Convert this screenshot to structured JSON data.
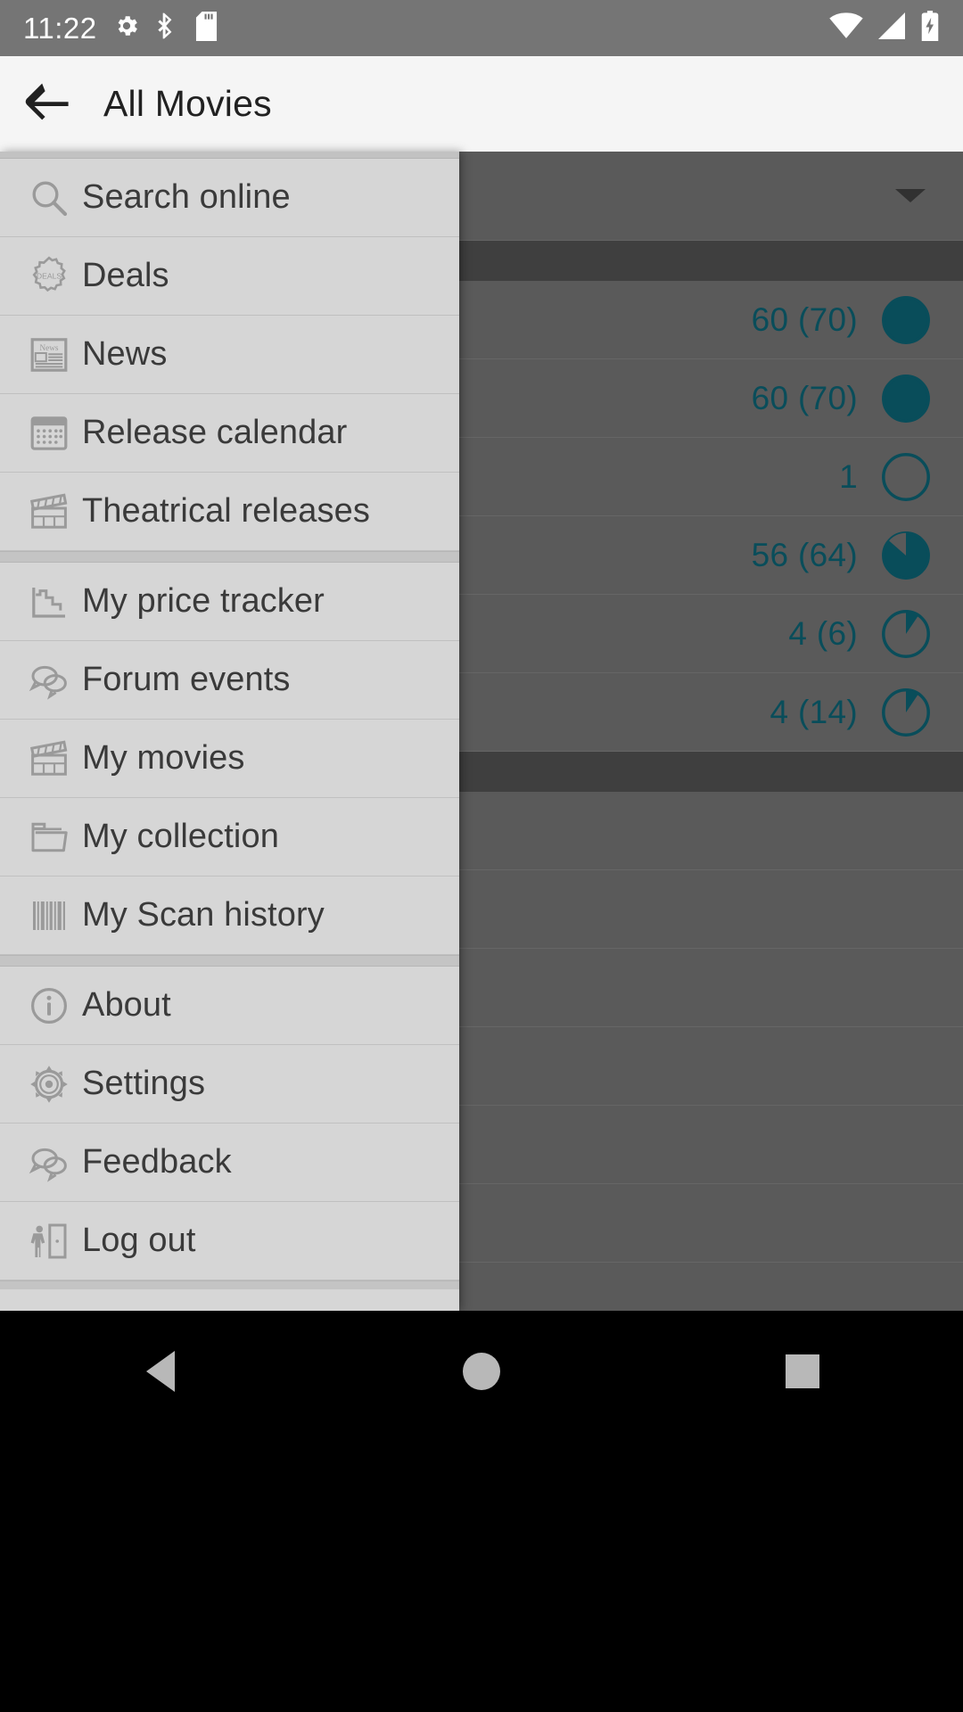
{
  "status_bar": {
    "time": "11:22",
    "left_icons": [
      "gear-icon",
      "bluetooth-b-icon",
      "sd-card-icon"
    ],
    "right_icons": [
      "wifi-icon",
      "cellular-signal-icon",
      "battery-charging-icon"
    ],
    "background": "#757575",
    "foreground": "#ffffff"
  },
  "app_bar": {
    "back_label": "back-arrow",
    "title": "All Movies",
    "background": "#f5f5f5",
    "title_color": "#212121"
  },
  "drawer": {
    "background": "#d6d6d6",
    "label_color": "#3a3a3a",
    "groups": [
      {
        "items": [
          {
            "label": "Search online",
            "icon": "magnifier-icon"
          },
          {
            "label": "Deals",
            "icon": "deals-badge-icon"
          },
          {
            "label": "News",
            "icon": "newspaper-icon"
          },
          {
            "label": "Release calendar",
            "icon": "calendar-icon"
          },
          {
            "label": "Theatrical releases",
            "icon": "clapperboard-icon"
          }
        ]
      },
      {
        "items": [
          {
            "label": "My price tracker",
            "icon": "line-chart-icon"
          },
          {
            "label": "Forum events",
            "icon": "speech-bubbles-icon"
          },
          {
            "label": "My movies",
            "icon": "clapperboard-icon"
          },
          {
            "label": "My collection",
            "icon": "folder-icon"
          },
          {
            "label": "My Scan history",
            "icon": "barcode-icon"
          }
        ]
      },
      {
        "items": [
          {
            "label": "About",
            "icon": "info-circle-icon"
          },
          {
            "label": "Settings",
            "icon": "gear-icon"
          },
          {
            "label": "Feedback",
            "icon": "speech-bubbles-icon"
          },
          {
            "label": "Log out",
            "icon": "exit-door-icon"
          }
        ]
      }
    ]
  },
  "content": {
    "background": "#6e6e6e",
    "accent_color": "#0b5e6e",
    "dropdown_caret": "chevron-down-icon",
    "rows": [
      {
        "count": "",
        "progress": null
      },
      {
        "count": "60 (70)",
        "progress": 100
      },
      {
        "count": "60 (70)",
        "progress": 100
      },
      {
        "count": "1",
        "progress": 0
      },
      {
        "count": "56 (64)",
        "progress": 82
      },
      {
        "count": "4 (6)",
        "progress": 14
      },
      {
        "count": "4 (14)",
        "progress": 14
      }
    ]
  },
  "nav_bar": {
    "background": "#000000",
    "buttons": [
      "back-triangle-icon",
      "home-circle-icon",
      "recents-square-icon"
    ]
  }
}
